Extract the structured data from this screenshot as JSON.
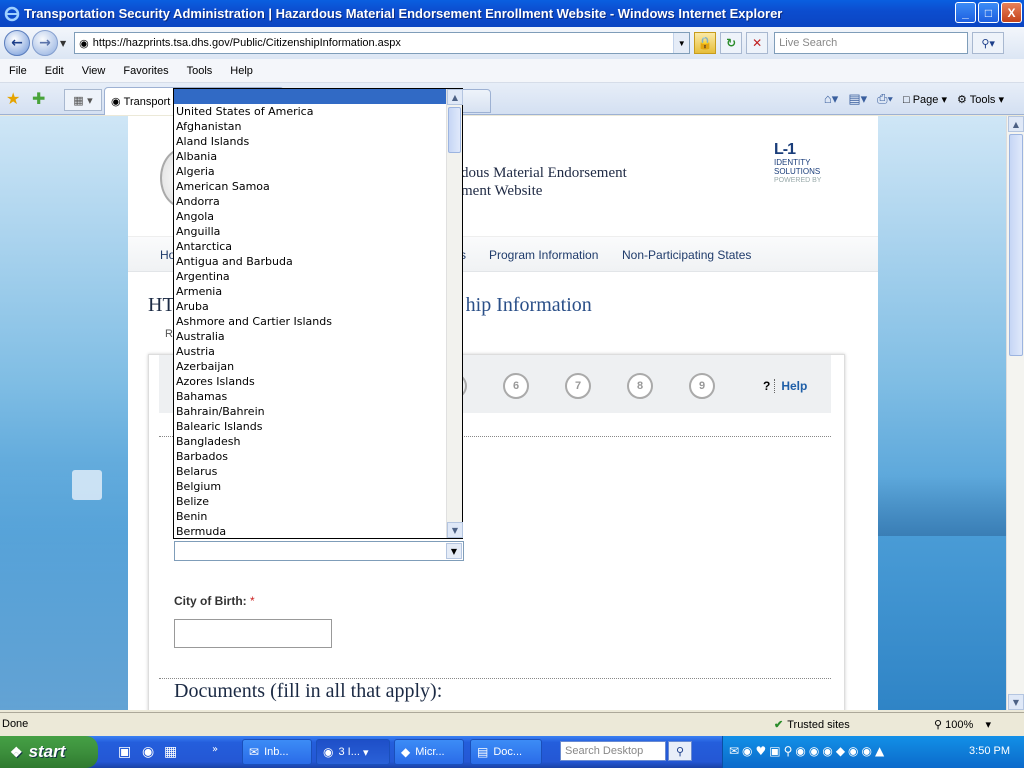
{
  "window": {
    "title": "Transportation Security Administration | Hazardous Material Endorsement Enrollment Website - Windows Internet Explorer",
    "buttons": {
      "minimize": "_",
      "maximize": "□",
      "close": "X"
    }
  },
  "address": {
    "url": "https://hazprints.tsa.dhs.gov/Public/CitizenshipInformation.aspx",
    "search_placeholder": "Live Search"
  },
  "menu": [
    "File",
    "Edit",
    "View",
    "Favorites",
    "Tools",
    "Help"
  ],
  "tabs": {
    "active_label": "Transport",
    "commands": {
      "page": "Page",
      "tools": "Tools"
    }
  },
  "page": {
    "site_title_line1": "dous Material Endorsement",
    "site_title_line2": "ment Website",
    "logo": {
      "line1": "L-1",
      "line2": "IDENTITY",
      "line3": "SOLUTIONS",
      "line4": "POWERED BY"
    },
    "nav": {
      "home": "Ho",
      "partial": "s",
      "program_info": "Program Information",
      "non_participating": "Non-Participating States"
    },
    "title_prefix": "HT",
    "title_suffix": "hip Information",
    "req_note_partial": "R",
    "steps": [
      "6",
      "7",
      "8",
      "9"
    ],
    "step_partial": ")",
    "help_q": "?",
    "help_label": "Help",
    "city_label": "City of Birth:",
    "required_mark": "*",
    "docs_title": "Documents (fill in all that apply):"
  },
  "dropdown": {
    "selected_index": 0,
    "options": [
      "",
      "United States of America",
      "Afghanistan",
      "Aland Islands",
      "Albania",
      "Algeria",
      "American Samoa",
      "Andorra",
      "Angola",
      "Anguilla",
      "Antarctica",
      "Antigua and Barbuda",
      "Argentina",
      "Armenia",
      "Aruba",
      "Ashmore and Cartier Islands",
      "Australia",
      "Austria",
      "Azerbaijan",
      "Azores Islands",
      "Bahamas",
      "Bahrain/Bahrein",
      "Balearic Islands",
      "Bangladesh",
      "Barbados",
      "Belarus",
      "Belgium",
      "Belize",
      "Benin",
      "Bermuda"
    ]
  },
  "status": {
    "left": "Done",
    "zone": "Trusted sites",
    "zoom": "100%"
  },
  "taskbar": {
    "start": "start",
    "buttons": [
      {
        "label": "Inb...",
        "icon": "outlook-icon"
      },
      {
        "label": "3 I...",
        "icon": "ie-icon"
      },
      {
        "label": "Micr...",
        "icon": "app-icon"
      },
      {
        "label": "Doc...",
        "icon": "word-icon"
      }
    ],
    "search_placeholder": "Search Desktop",
    "clock": "3:50 PM"
  },
  "colors": {
    "selection": "#316AC5",
    "accent": "#1f5fa8",
    "required": "#cc2222"
  }
}
